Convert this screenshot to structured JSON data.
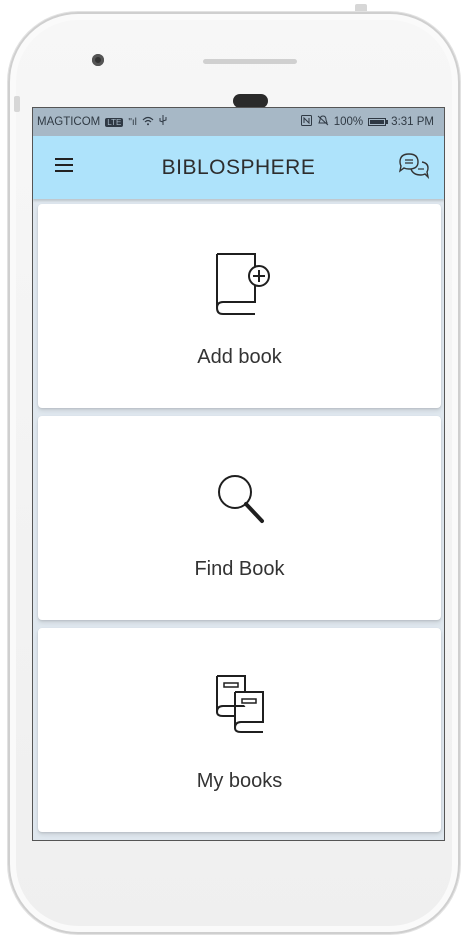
{
  "status_bar": {
    "carrier": "MAGTICOM",
    "network_badge": "LTE",
    "signal_text": "\"ıl",
    "wifi_icon": "wifi-icon",
    "usb_icon": "usb-icon",
    "nfc_icon": "nfc-icon",
    "mute_icon": "mute-icon",
    "battery_percent": "100%",
    "time": "3:31 PM"
  },
  "app_bar": {
    "title": "BIBLOSPHERE",
    "menu_icon": "menu-icon",
    "chat_icon": "chat-icon",
    "background": "#aee3fb"
  },
  "cards": [
    {
      "label": "Add book",
      "icon": "add-book-icon"
    },
    {
      "label": "Find Book",
      "icon": "search-icon"
    },
    {
      "label": "My books",
      "icon": "books-icon"
    }
  ]
}
